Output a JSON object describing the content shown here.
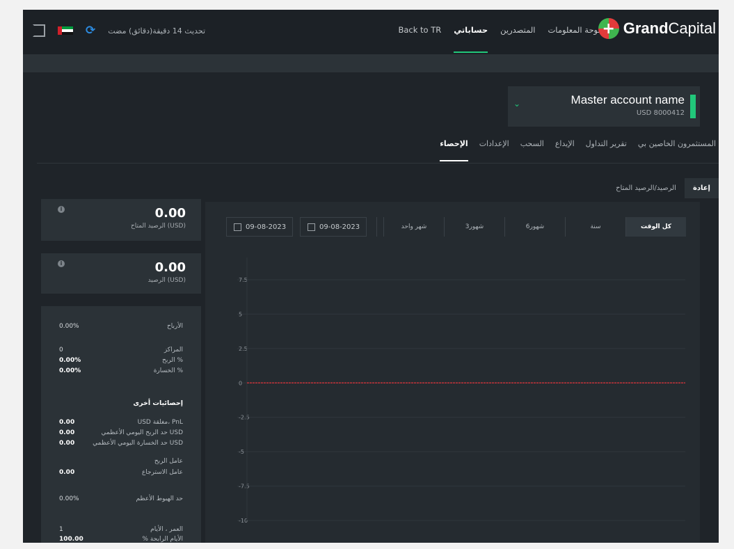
{
  "topbar": {
    "update_text": "تحديث 14 دقيقة(دقائق) مضت",
    "nav": [
      "لوحة المعلومات",
      "المتصدرين",
      "حساباتي",
      "Back to TR"
    ],
    "active_nav": "حساباتي",
    "logo_bold": "Grand",
    "logo_regular": "Capital"
  },
  "account": {
    "name": "Master account name",
    "number": "USD  8000412"
  },
  "tabs": [
    "المستثمرون الخاصين بي",
    "تقرير التداول",
    "الإيداع",
    "السحب",
    "الإعدادات",
    "الإحصاء"
  ],
  "active_tab": "الإحصاء",
  "subtabs": {
    "left": "الرصيد/الرصيد المتاح",
    "right": "إعادة"
  },
  "cards": [
    {
      "value": "0.00",
      "label": "الرصيد المتاح (USD)"
    },
    {
      "value": "0.00",
      "label": "الرصيد (USD)"
    }
  ],
  "stats": {
    "profit": {
      "label": "الأرباح",
      "value": "0.00%"
    },
    "positions": {
      "label": "المراكز",
      "value": "0"
    },
    "profit_pct": {
      "label": "الربح %",
      "value": "0.00%"
    },
    "loss_pct": {
      "label": "الخسارة %",
      "value": "0.00%"
    },
    "other_heading": "إحصائيات أخرى",
    "closed_pnl": {
      "label": "USD مغلقة، PnL",
      "value": "0.00"
    },
    "max_daily_profit": {
      "label": "حد الربح اليومي الأعظمي USD",
      "value": "0.00"
    },
    "max_daily_loss": {
      "label": "حد الخسارة اليومي الأعظمي USD",
      "value": "0.00"
    },
    "profit_factor": {
      "label": "عامل الربح",
      "value": ""
    },
    "recovery_factor": {
      "label": "عامل الاسترجاع",
      "value": "0.00"
    },
    "max_drawdown": {
      "label": "حد الهبوط الأعظم",
      "value": "0.00%"
    },
    "age_days": {
      "label": "العمر ، الأيام",
      "value": "1"
    },
    "last_row": {
      "label": "% الأيام الرابحة",
      "value": "100.00"
    }
  },
  "chart_controls": {
    "date_from": "09-08-2023",
    "date_to": "09-08-2023",
    "periods": [
      "كل الوقت",
      "سنة",
      "6شهور",
      "3شهور",
      "شهر واحد"
    ],
    "active_period": "كل الوقت"
  },
  "chart_data": {
    "type": "line",
    "y_ticks": [
      "7.5",
      "5",
      "2.5",
      "0",
      "-2.5",
      "-5",
      "-7.5",
      "-10"
    ],
    "y_values": [
      7.5,
      5,
      2.5,
      0,
      -2.5,
      -5,
      -7.5,
      -10
    ],
    "ylim": [
      -10,
      7.5
    ],
    "series": [
      {
        "values": [
          0,
          0
        ],
        "color": "#d0333a"
      }
    ],
    "grid": true
  }
}
